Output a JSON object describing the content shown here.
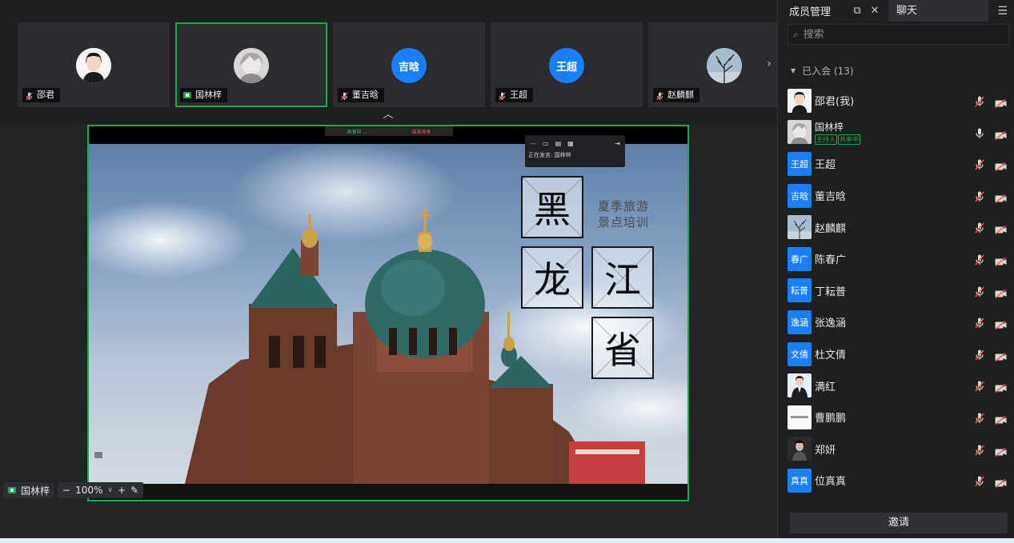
{
  "thumbnails": [
    {
      "name": "邵君",
      "avatar_text": "",
      "avatar_color": "#f2f2f2",
      "kind": "photo-woman",
      "status": "muted",
      "active": false
    },
    {
      "name": "国林梓",
      "avatar_text": "",
      "avatar_color": "#d9d6d8",
      "kind": "photo-anime",
      "status": "sharing",
      "active": true
    },
    {
      "name": "董吉晗",
      "avatar_text": "吉晗",
      "avatar_color": "#1a7ff5",
      "kind": "text",
      "status": "muted",
      "active": false
    },
    {
      "name": "王超",
      "avatar_text": "王超",
      "avatar_color": "#1a7ff5",
      "kind": "text",
      "status": "muted",
      "active": false
    },
    {
      "name": "赵麟麒",
      "avatar_text": "",
      "avatar_color": "#9fb4c9",
      "kind": "photo-tree",
      "status": "muted",
      "active": false
    }
  ],
  "share": {
    "toolbar_left": "共享中 ...",
    "toolbar_right": "结束共享",
    "presenter_label": "正在发言: 国林梓",
    "slide_chars": [
      "黑",
      "龙",
      "江",
      "省"
    ],
    "slide_subtitle_1": "夏季旅游",
    "slide_subtitle_2": "景点培训"
  },
  "bottom_bar": {
    "sharer_name": "国林梓",
    "zoom_minus": "−",
    "zoom_level": "100%",
    "zoom_plus": "+"
  },
  "panel": {
    "members_tab": "成员管理",
    "chat_tab": "聊天",
    "search_placeholder": "搜索",
    "joined_label": "已入会 (13)",
    "invite_label": "邀请",
    "members": [
      {
        "name": "邵君(我)",
        "avatar_text": "",
        "avatar_color": "#f0f0f0",
        "kind": "photo-woman",
        "mic": "muted",
        "roles": []
      },
      {
        "name": "国林梓",
        "avatar_text": "",
        "avatar_color": "#d9d6d8",
        "kind": "photo-anime",
        "mic": "on",
        "roles": [
          "主持人",
          "共享中"
        ]
      },
      {
        "name": "王超",
        "avatar_text": "王超",
        "avatar_color": "#1a7ff5",
        "kind": "text",
        "mic": "muted",
        "roles": []
      },
      {
        "name": "董吉晗",
        "avatar_text": "吉晗",
        "avatar_color": "#1a7ff5",
        "kind": "text",
        "mic": "muted",
        "roles": []
      },
      {
        "name": "赵麟麒",
        "avatar_text": "",
        "avatar_color": "#9fb4c9",
        "kind": "photo-tree",
        "mic": "muted",
        "roles": []
      },
      {
        "name": "陈春广",
        "avatar_text": "春广",
        "avatar_color": "#1a7ff5",
        "kind": "text",
        "mic": "muted",
        "roles": []
      },
      {
        "name": "丁耘普",
        "avatar_text": "耘普",
        "avatar_color": "#1a7ff5",
        "kind": "text",
        "mic": "muted",
        "roles": []
      },
      {
        "name": "张逸涵",
        "avatar_text": "逸涵",
        "avatar_color": "#1a7ff5",
        "kind": "text",
        "mic": "muted",
        "roles": []
      },
      {
        "name": "杜文倩",
        "avatar_text": "文倩",
        "avatar_color": "#1a7ff5",
        "kind": "text",
        "mic": "muted",
        "roles": []
      },
      {
        "name": "满红",
        "avatar_text": "",
        "avatar_color": "#e8e8e8",
        "kind": "photo-suit",
        "mic": "muted",
        "roles": []
      },
      {
        "name": "曹鹏鹏",
        "avatar_text": "",
        "avatar_color": "#ffffff",
        "kind": "photo-white",
        "mic": "muted",
        "roles": []
      },
      {
        "name": "郑妍",
        "avatar_text": "",
        "avatar_color": "#3a3a3a",
        "kind": "photo-dark",
        "mic": "muted",
        "roles": []
      },
      {
        "name": "位真真",
        "avatar_text": "真真",
        "avatar_color": "#1a7ff5",
        "kind": "text",
        "mic": "muted",
        "roles": []
      }
    ]
  },
  "colors": {
    "accent_green": "#1fa84a",
    "avatar_blue": "#1a7ff5",
    "muted_red": "#ff5a4d"
  }
}
